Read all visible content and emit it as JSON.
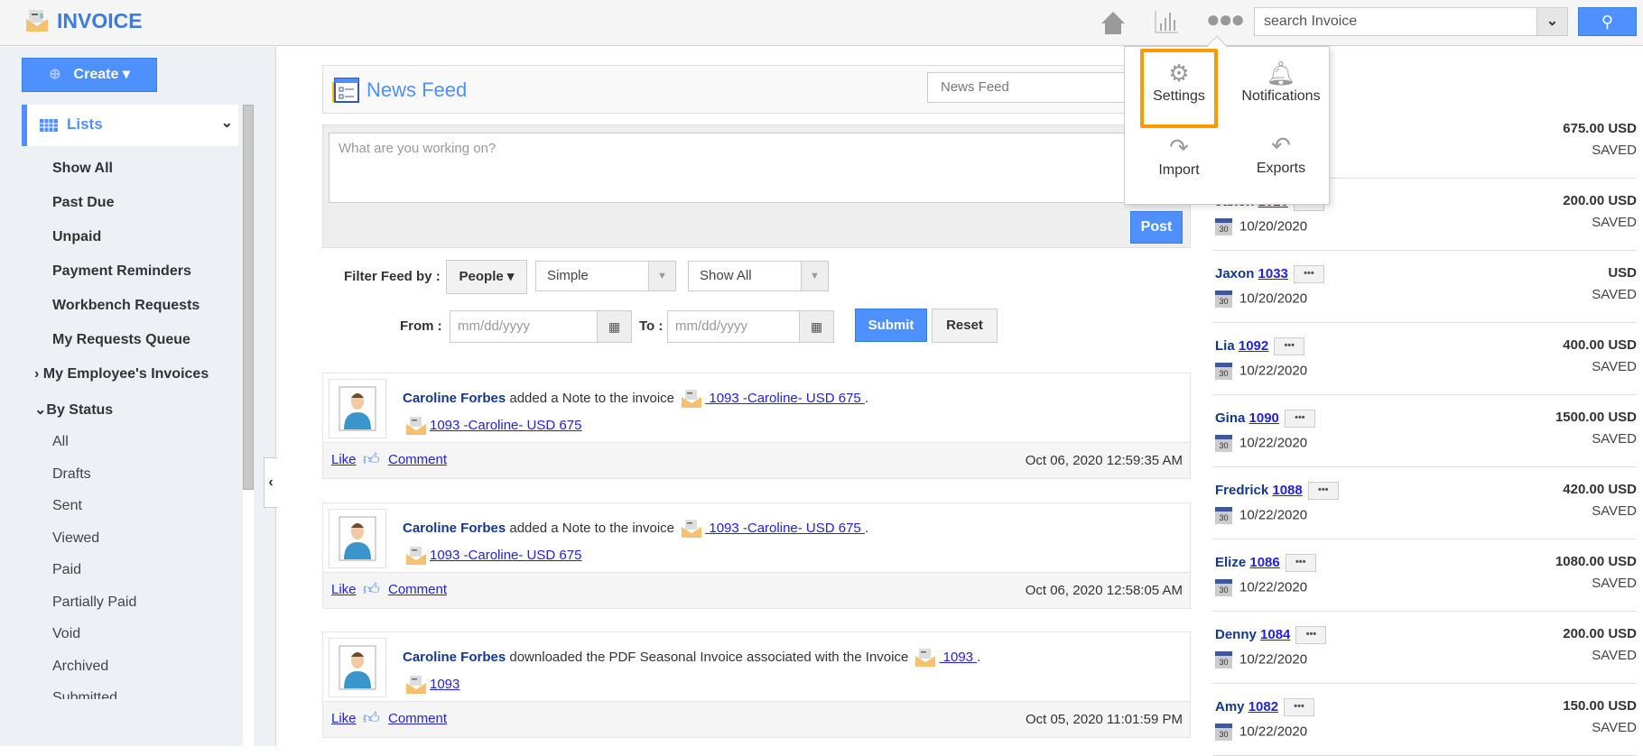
{
  "header": {
    "app_title": "INVOICE",
    "search_placeholder": "search Invoice"
  },
  "sidebar": {
    "create_label": "Create",
    "lists_label": "Lists",
    "items": [
      "Show All",
      "Past Due",
      "Unpaid",
      "Payment Reminders",
      "Workbench Requests",
      "My Requests Queue"
    ],
    "employee_invoices": "My Employee's Invoices",
    "by_status": "By Status",
    "status_items": [
      "All",
      "Drafts",
      "Sent",
      "Viewed",
      "Paid",
      "Partially Paid",
      "Void",
      "Archived",
      "Submitted"
    ]
  },
  "main": {
    "title": "News Feed",
    "feed_select": "News Feed",
    "post_placeholder": "What are you working on?",
    "post_label": "Post",
    "filter_label": "Filter Feed by :",
    "people_label": "People",
    "simple_value": "Simple",
    "show_value": "Show All",
    "from_label": "From :",
    "to_label": "To :",
    "date_placeholder": "mm/dd/yyyy",
    "submit_label": "Submit",
    "reset_label": "Reset",
    "like": "Like",
    "comment": "Comment",
    "feed": [
      {
        "user": "Caroline Forbes",
        "action": "added a Note to the invoice",
        "link": " 1093 -Caroline- USD 675 ",
        "link2": "1093 -Caroline- USD 675",
        "time": "Oct 06, 2020 12:59:35 AM"
      },
      {
        "user": "Caroline Forbes",
        "action": "added a Note to the invoice",
        "link": " 1093 -Caroline- USD 675 ",
        "link2": "1093 -Caroline- USD 675",
        "time": "Oct 06, 2020 12:58:05 AM"
      },
      {
        "user": "Caroline Forbes",
        "action": "downloaded the PDF Seasonal Invoice associated with the Invoice",
        "link": " 1093 ",
        "link2": "1093",
        "time": "Oct 05, 2020 11:01:59 PM"
      }
    ]
  },
  "right": {
    "title_visible": "ce",
    "invoices": [
      {
        "name": "",
        "num": "",
        "date": "",
        "amount": "675.00 USD",
        "status": "SAVED"
      },
      {
        "name": "Jaxon",
        "num": "1026",
        "date": "10/20/2020",
        "amount": "200.00 USD",
        "status": "SAVED"
      },
      {
        "name": "Jaxon",
        "num": "1033",
        "date": "10/20/2020",
        "amount": "USD",
        "status": "SAVED"
      },
      {
        "name": "Lia",
        "num": "1092",
        "date": "10/22/2020",
        "amount": "400.00 USD",
        "status": "SAVED"
      },
      {
        "name": "Gina",
        "num": "1090",
        "date": "10/22/2020",
        "amount": "1500.00 USD",
        "status": "SAVED"
      },
      {
        "name": "Fredrick",
        "num": "1088",
        "date": "10/22/2020",
        "amount": "420.00 USD",
        "status": "SAVED"
      },
      {
        "name": "Elize",
        "num": "1086",
        "date": "10/22/2020",
        "amount": "1080.00 USD",
        "status": "SAVED"
      },
      {
        "name": "Denny",
        "num": "1084",
        "date": "10/22/2020",
        "amount": "200.00 USD",
        "status": "SAVED"
      },
      {
        "name": "Amy",
        "num": "1082",
        "date": "10/22/2020",
        "amount": "150.00 USD",
        "status": "SAVED"
      }
    ]
  },
  "dropdown": {
    "settings": "Settings",
    "notifications": "Notifications",
    "import": "Import",
    "exports": "Exports"
  },
  "calendar_day": "30",
  "colors": {
    "accent": "#4d90fe",
    "highlight": "#ff9900"
  }
}
